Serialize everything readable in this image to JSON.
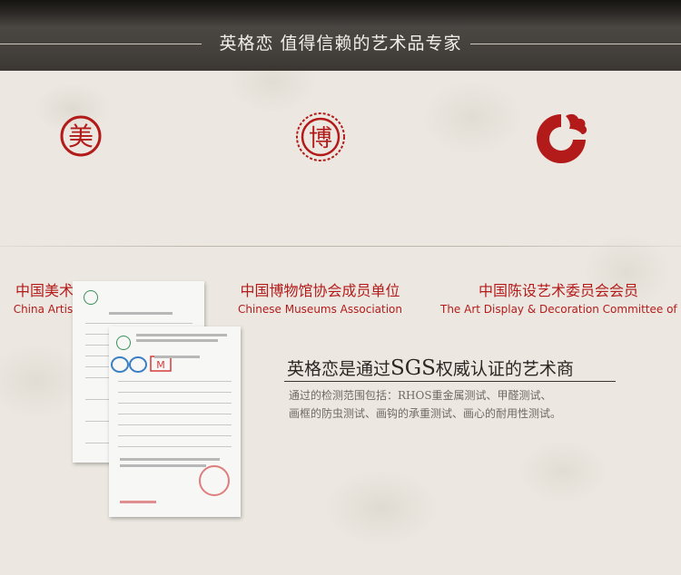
{
  "header": {
    "title": "英格恋  值得信赖的艺术品专家"
  },
  "associations": [
    {
      "name_cn": "中国美术家协会会员",
      "name_en": "China Artists Association",
      "logo": "mei-seal-icon",
      "logo_char": "美"
    },
    {
      "name_cn": "中国博物馆协会成员单位",
      "name_en": "Chinese Museums Association",
      "logo": "museum-seal-icon",
      "logo_char": "博"
    },
    {
      "name_cn": "中国陈设艺术委员会会员",
      "name_en": "The Art Display & Decoration Committee of China",
      "logo": "cloud-ring-logo-icon"
    }
  ],
  "certification": {
    "title_prefix": "英格恋是通过",
    "title_highlight": "SGS",
    "title_suffix": "权威认证的艺术商",
    "desc_line1": "通过的检测范围包括：RHOS重金属测试、甲醛测试、",
    "desc_line2": "画框的防虫测试、画钩的承重测试、画心的耐用性测试。",
    "cert_images": [
      "certificate-document-icon",
      "inspection-report-document-icon"
    ]
  },
  "colors": {
    "accent_red": "#b31b1b",
    "header_bg": "#433f3b",
    "page_bg": "#ece8e1"
  }
}
